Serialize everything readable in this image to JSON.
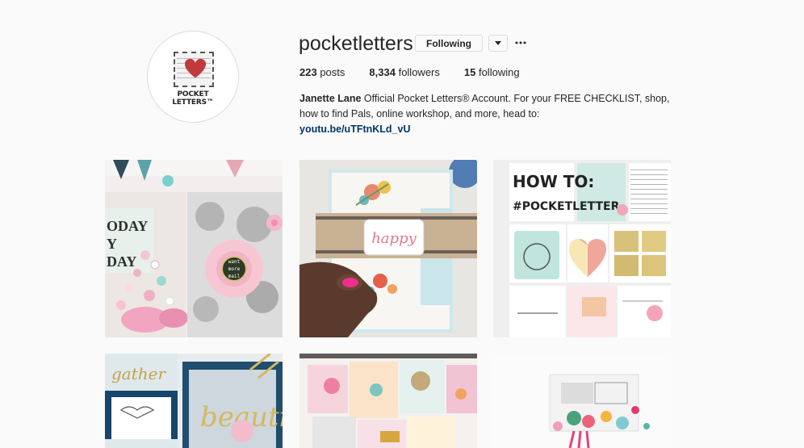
{
  "profile": {
    "username": "pocketletters",
    "follow_label": "Following",
    "avatar_text": "POCKET LETTERS™",
    "stats": [
      {
        "value": "223",
        "label": "posts"
      },
      {
        "value": "8,334",
        "label": "followers"
      },
      {
        "value": "15",
        "label": "following"
      }
    ],
    "bio_name": "Janette Lane",
    "bio_text": " Official Pocket Letters® Account. For your FREE CHECKLIST, shop, how to find Pals, online workshop, and more, head to:",
    "bio_link": "youtu.be/uTFtnKLd_vU"
  },
  "posts": {
    "post1": {
      "badge_text": [
        "want",
        "more",
        "mail"
      ],
      "side_text": [
        "ODAY",
        "Y",
        "DAY"
      ]
    },
    "post2": {
      "tag_text": "happy"
    },
    "post3": {
      "title_top": "HOW TO:",
      "title_bottom": "#POCKETLETTER"
    },
    "post4": {
      "script_text": "gather",
      "big_text": "beautiful"
    },
    "post5": {},
    "post6": {}
  },
  "colors": {
    "background": "#fafafa",
    "link": "#003569",
    "border": "#dbdbdb",
    "heart": "#c0393b"
  }
}
